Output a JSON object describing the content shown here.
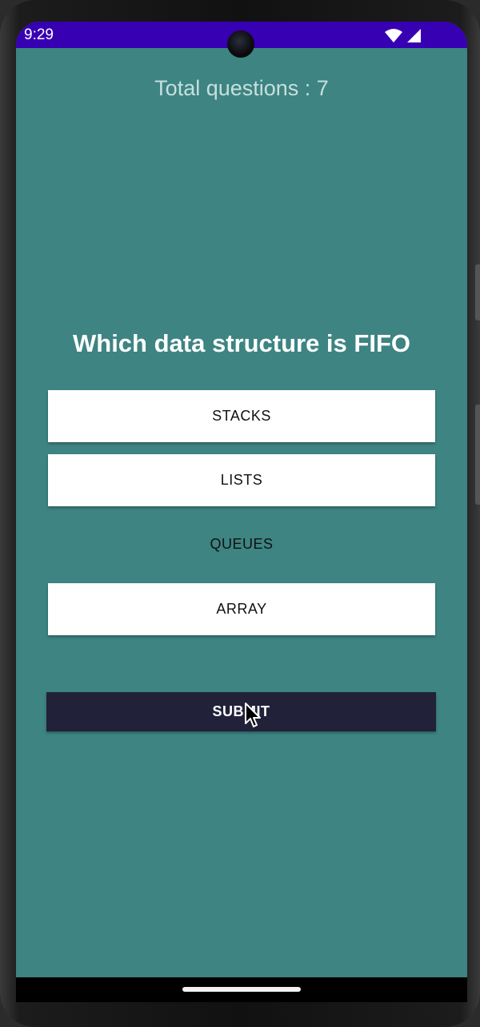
{
  "status_bar": {
    "time": "9:29",
    "color": "#3700b3",
    "icons": [
      "wifi-icon",
      "signal-icon"
    ]
  },
  "quiz": {
    "total_questions_label": "Total questions : 7",
    "question": "Which data structure is FIFO",
    "options": [
      "STACKS",
      "LISTS",
      "QUEUES",
      "ARRAY"
    ],
    "selected_option": "QUEUES",
    "submit_label": "SUBMIT"
  },
  "colors": {
    "background": "#3d8482",
    "option_background": "#ffffff",
    "submit_background": "#22213a"
  }
}
